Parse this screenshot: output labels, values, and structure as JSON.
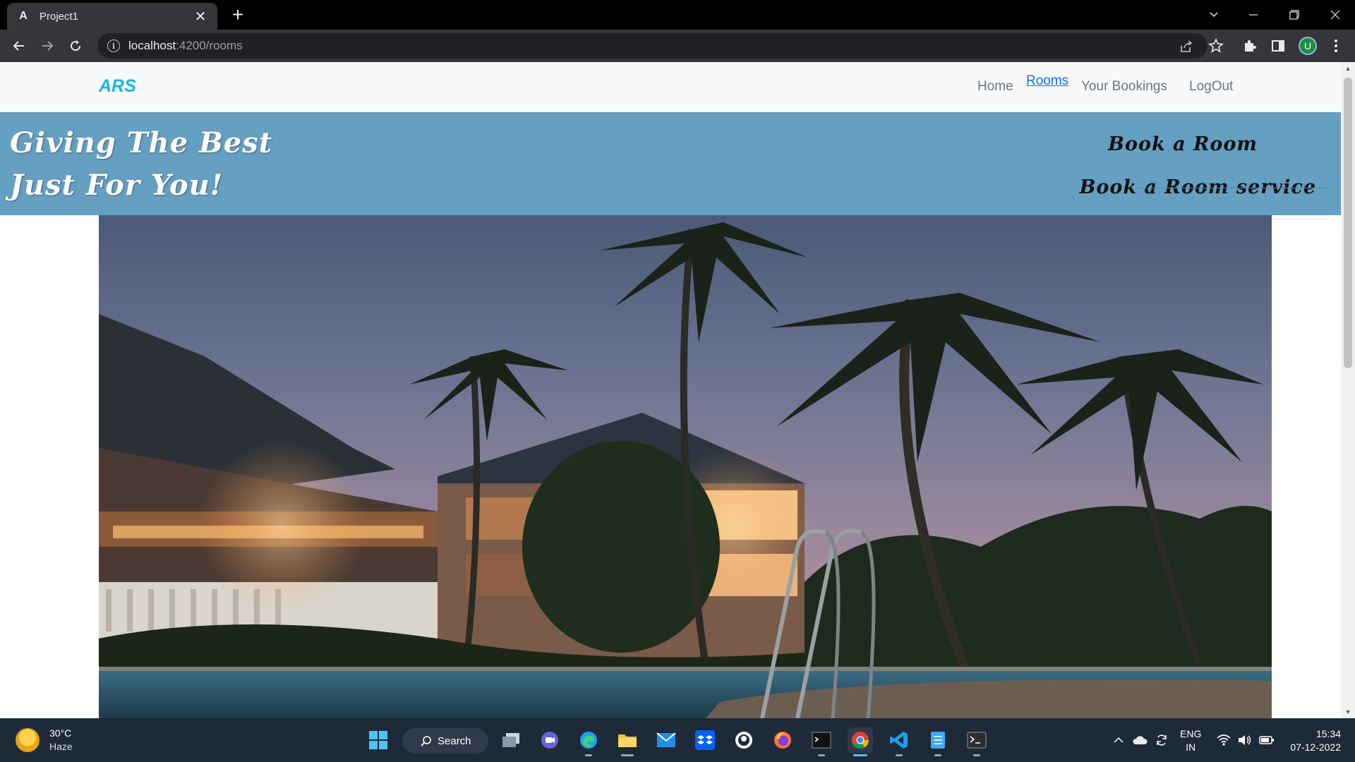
{
  "browser": {
    "tab_title": "Project1",
    "tab_favicon": "A",
    "url_host": "localhost",
    "url_rest": ":4200/rooms",
    "profile_initial": "U",
    "close_glyph": "✕",
    "new_tab_glyph": "+",
    "info_glyph": "i"
  },
  "navbar": {
    "brand": "ARS",
    "links": [
      {
        "label": "Home",
        "active": false
      },
      {
        "label": "Rooms",
        "active": true
      },
      {
        "label": "Your Bookings",
        "active": false
      },
      {
        "label": "LogOut",
        "active": false
      }
    ]
  },
  "hero": {
    "tagline_line1": "Giving The Best",
    "tagline_line2": "Just For You!",
    "book_room": "Book a Room",
    "book_room_service": "Book a Room service",
    "background_color": "#659fc2"
  },
  "taskbar": {
    "weather_temp": "30°C",
    "weather_desc": "Haze",
    "search_label": "Search",
    "language": "ENG",
    "region": "IN",
    "time": "15:34",
    "date": "07-12-2022"
  },
  "icons": {
    "back": "back-arrow-icon",
    "forward": "forward-arrow-icon",
    "reload": "reload-icon",
    "share": "share-icon",
    "star": "bookmark-star-icon",
    "extensions": "puzzle-icon",
    "sidepanel": "side-panel-icon",
    "menu": "kebab-menu-icon"
  }
}
